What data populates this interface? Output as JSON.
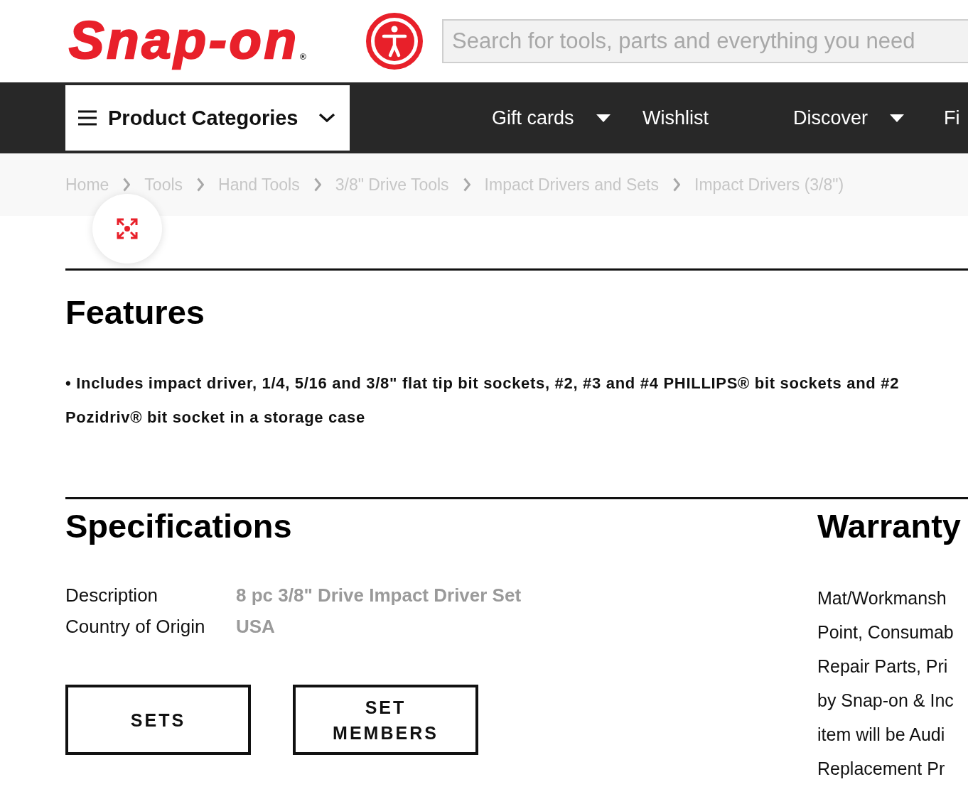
{
  "header": {
    "logo": {
      "text": "Snap-on",
      "mark": "®"
    },
    "search": {
      "placeholder": "Search for tools, parts and everything you need"
    }
  },
  "nav": {
    "categories_button": {
      "label": "Product Categories"
    },
    "items": [
      {
        "label": "Gift cards",
        "dropdown": true
      },
      {
        "label": "Wishlist",
        "dropdown": false
      },
      {
        "label": "Discover",
        "dropdown": true
      },
      {
        "label": "Fi",
        "dropdown": false
      }
    ]
  },
  "breadcrumb": [
    "Home",
    "Tools",
    "Hand Tools",
    "3/8\" Drive Tools",
    "Impact Drivers and Sets",
    "Impact Drivers (3/8\")"
  ],
  "features": {
    "title": "Features",
    "text": "• Includes impact driver, 1/4, 5/16 and 3/8\" flat tip bit sockets, #2, #3 and #4 PHILLIPS® bit sockets and #2 Pozidriv® bit socket in a storage case"
  },
  "specifications": {
    "title": "Specifications",
    "rows": [
      {
        "label": "Description",
        "value": "8 pc 3/8\" Drive Impact Driver Set"
      },
      {
        "label": "Country of Origin",
        "value": "USA"
      }
    ],
    "buttons": [
      "SETS",
      "SET MEMBERS"
    ]
  },
  "warranty": {
    "title": "Warranty",
    "text_lines": [
      "Mat/Workmansh",
      "Point, Consumab",
      "Repair Parts, Pri",
      "by Snap-on & Inc",
      "item will be Audi",
      "Replacement Pr"
    ]
  }
}
